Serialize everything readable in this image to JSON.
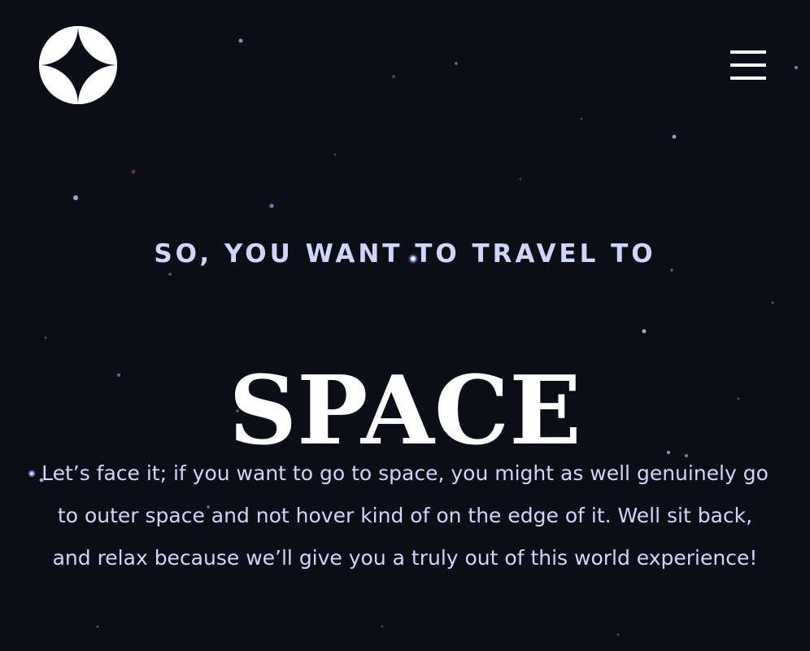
{
  "header": {
    "logo_icon": "four-point-star-icon",
    "menu_icon": "hamburger-menu-icon"
  },
  "hero": {
    "eyebrow": "SO, YOU WANT TO TRAVEL TO",
    "headline": "SPACE",
    "description": "Let’s face it; if you want to go to space, you might as well genuinely go to outer space and not hover kind of on the edge of it. Well sit back, and relax because we’ll give you a truly out of this world experience!"
  },
  "colors": {
    "background": "#0b0d17",
    "text_primary": "#ffffff",
    "text_secondary": "#d0d6f9"
  }
}
